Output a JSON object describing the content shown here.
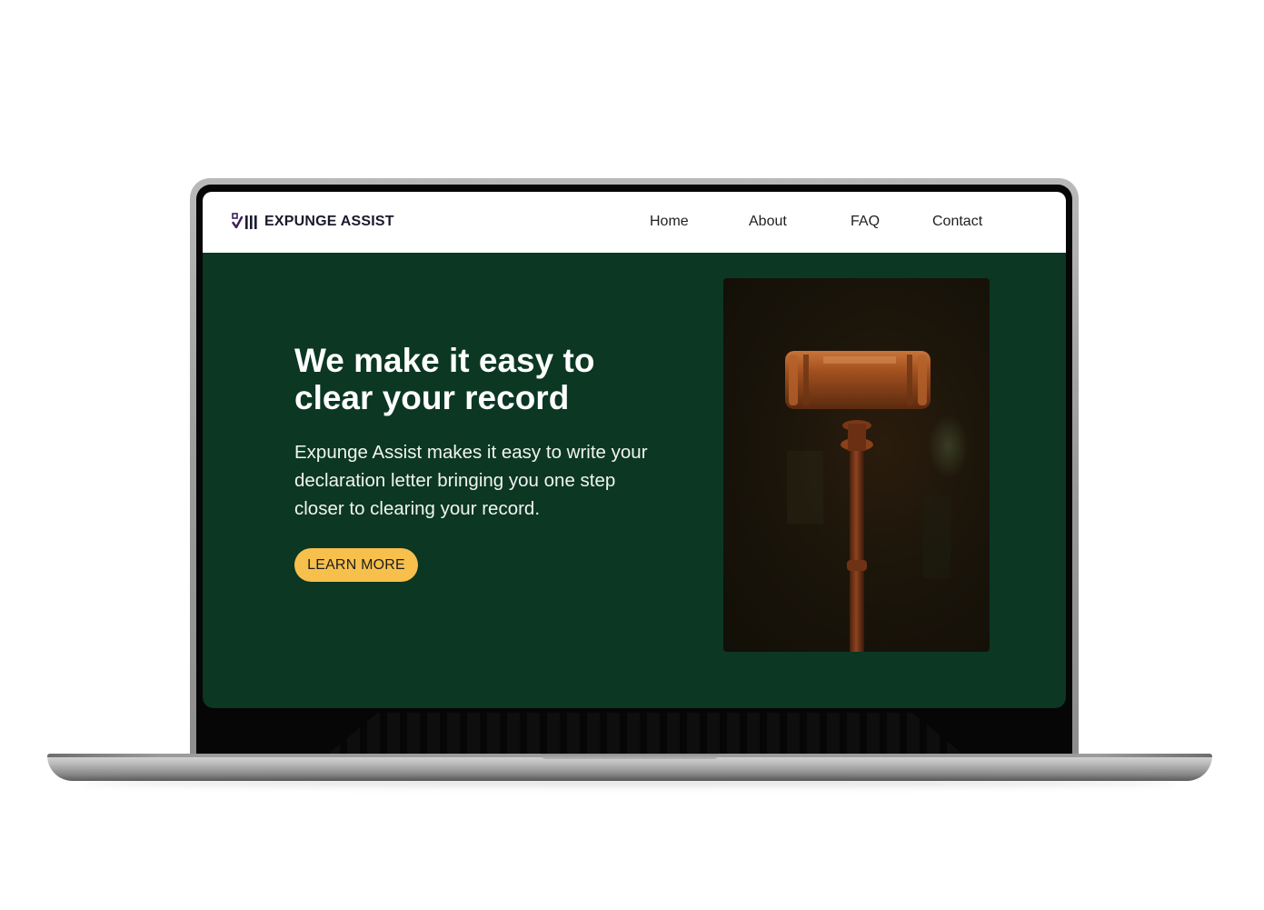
{
  "brand": {
    "name": "EXPUNGE ASSIST",
    "logo_icon": "check-bars-logo-icon"
  },
  "nav": {
    "links": [
      {
        "label": "Home"
      },
      {
        "label": "About"
      },
      {
        "label": "FAQ"
      },
      {
        "label": "Contact"
      }
    ]
  },
  "hero": {
    "title": "We make it easy to clear your record",
    "body": "Expunge Assist makes it easy to write your declaration letter bringing you one step closer to clearing your record.",
    "cta_label": "LEARN MORE",
    "image_subject": "gavel-image"
  },
  "colors": {
    "hero_bg": "#0b3723",
    "cta_bg": "#f7c04c",
    "nav_bg": "#ffffff",
    "logo_accent": "#3b1f5c"
  }
}
